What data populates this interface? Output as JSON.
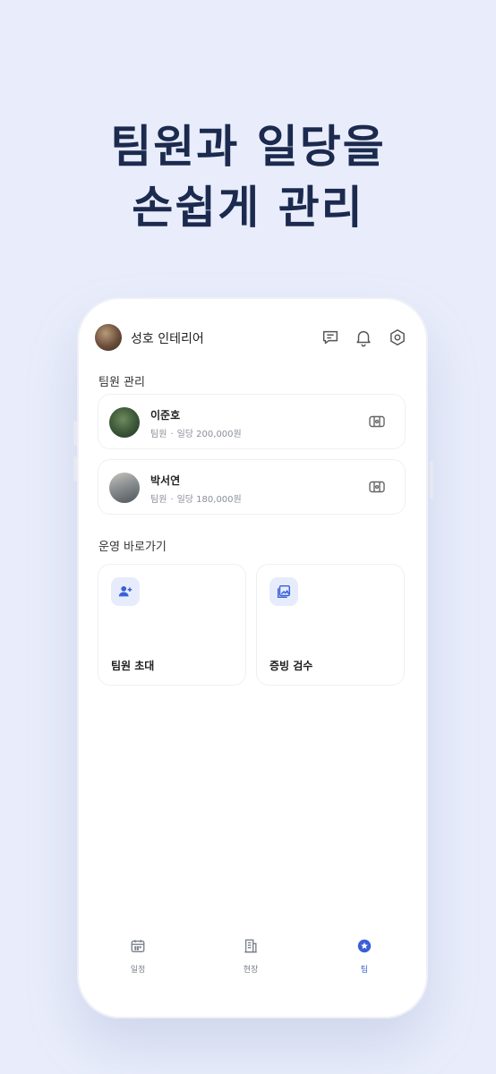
{
  "headline": {
    "line1": "팀원과 일당을",
    "line2": "손쉽게 관리"
  },
  "header": {
    "company_name": "성호 인테리어",
    "icons": [
      "chat-icon",
      "bell-icon",
      "settings-icon"
    ]
  },
  "team_section": {
    "title": "팀원 관리",
    "members": [
      {
        "name": "이준호",
        "role": "팀원",
        "separator": "·",
        "wage": "일당 200,000원"
      },
      {
        "name": "박서연",
        "role": "팀원",
        "separator": "·",
        "wage": "일당 180,000원"
      }
    ]
  },
  "shortcuts_section": {
    "title": "운영 바로가기",
    "items": [
      {
        "label": "팀원 초대",
        "icon": "add-person-icon"
      },
      {
        "label": "증빙 검수",
        "icon": "photo-icon"
      }
    ]
  },
  "bottom_nav": {
    "items": [
      {
        "label": "일정",
        "icon": "calendar-icon",
        "active": false
      },
      {
        "label": "현장",
        "icon": "building-icon",
        "active": false
      },
      {
        "label": "팀",
        "icon": "star-badge-icon",
        "active": true
      }
    ]
  },
  "colors": {
    "background": "#e9edfb",
    "headline": "#1b2a4e",
    "accent": "#3b5fd9",
    "icon_tile": "#e6ecfc"
  }
}
